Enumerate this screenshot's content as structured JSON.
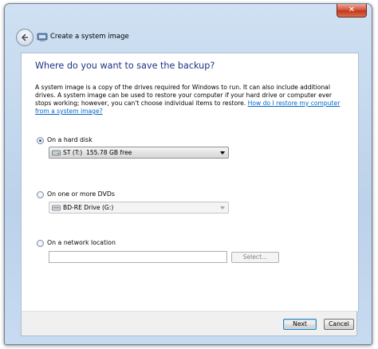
{
  "window": {
    "title": "Create a system image",
    "close_label": "✕"
  },
  "main": {
    "heading": "Where do you want to save the backup?",
    "description": "A system image is a copy of the drives required for Windows to run. It can also include additional drives. A system image can be used to restore your computer if your hard drive or computer ever stops working; however, you can't choose individual items to restore. ",
    "help_link": "How do I restore my computer from a system image?"
  },
  "options": {
    "hard_disk": {
      "label": "On a hard disk",
      "selected": true,
      "value": "ST (T:)  155.78 GB free"
    },
    "dvd": {
      "label": "On one or more DVDs",
      "selected": false,
      "value": "BD-RE Drive (G:)"
    },
    "network": {
      "label": "On a network location",
      "selected": false,
      "value": "",
      "select_button": "Select..."
    }
  },
  "footer": {
    "next_label": "Next",
    "cancel_label": "Cancel"
  },
  "colors": {
    "heading": "#1e3287",
    "link": "#0066cc",
    "close_button": "#c2361c"
  }
}
